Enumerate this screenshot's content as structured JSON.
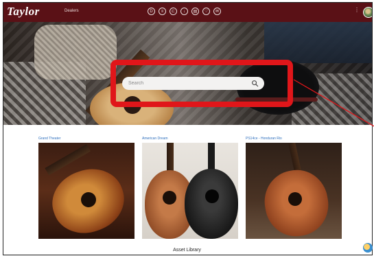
{
  "header": {
    "logo_text": "Taylor",
    "nav_link": "Dealers",
    "icons": [
      "document-icon",
      "list-icon",
      "folder-icon",
      "download-icon",
      "archive-icon",
      "heart-icon",
      "chat-icon"
    ],
    "icon_glyphs": [
      "D",
      "≡",
      "⊏",
      "↓",
      "▤",
      "♡",
      "✉"
    ],
    "menu_glyph": "⋮"
  },
  "search": {
    "placeholder": "Search",
    "value": ""
  },
  "highlight_color": "#e0161a",
  "cards": [
    {
      "title": "Grand Theater"
    },
    {
      "title": "American Dream"
    },
    {
      "title": "PS14ce - Honduran Rio"
    }
  ],
  "footer": {
    "label": "Asset Library"
  },
  "colors": {
    "brand": "#5a1116",
    "link": "#2e6fbd"
  }
}
